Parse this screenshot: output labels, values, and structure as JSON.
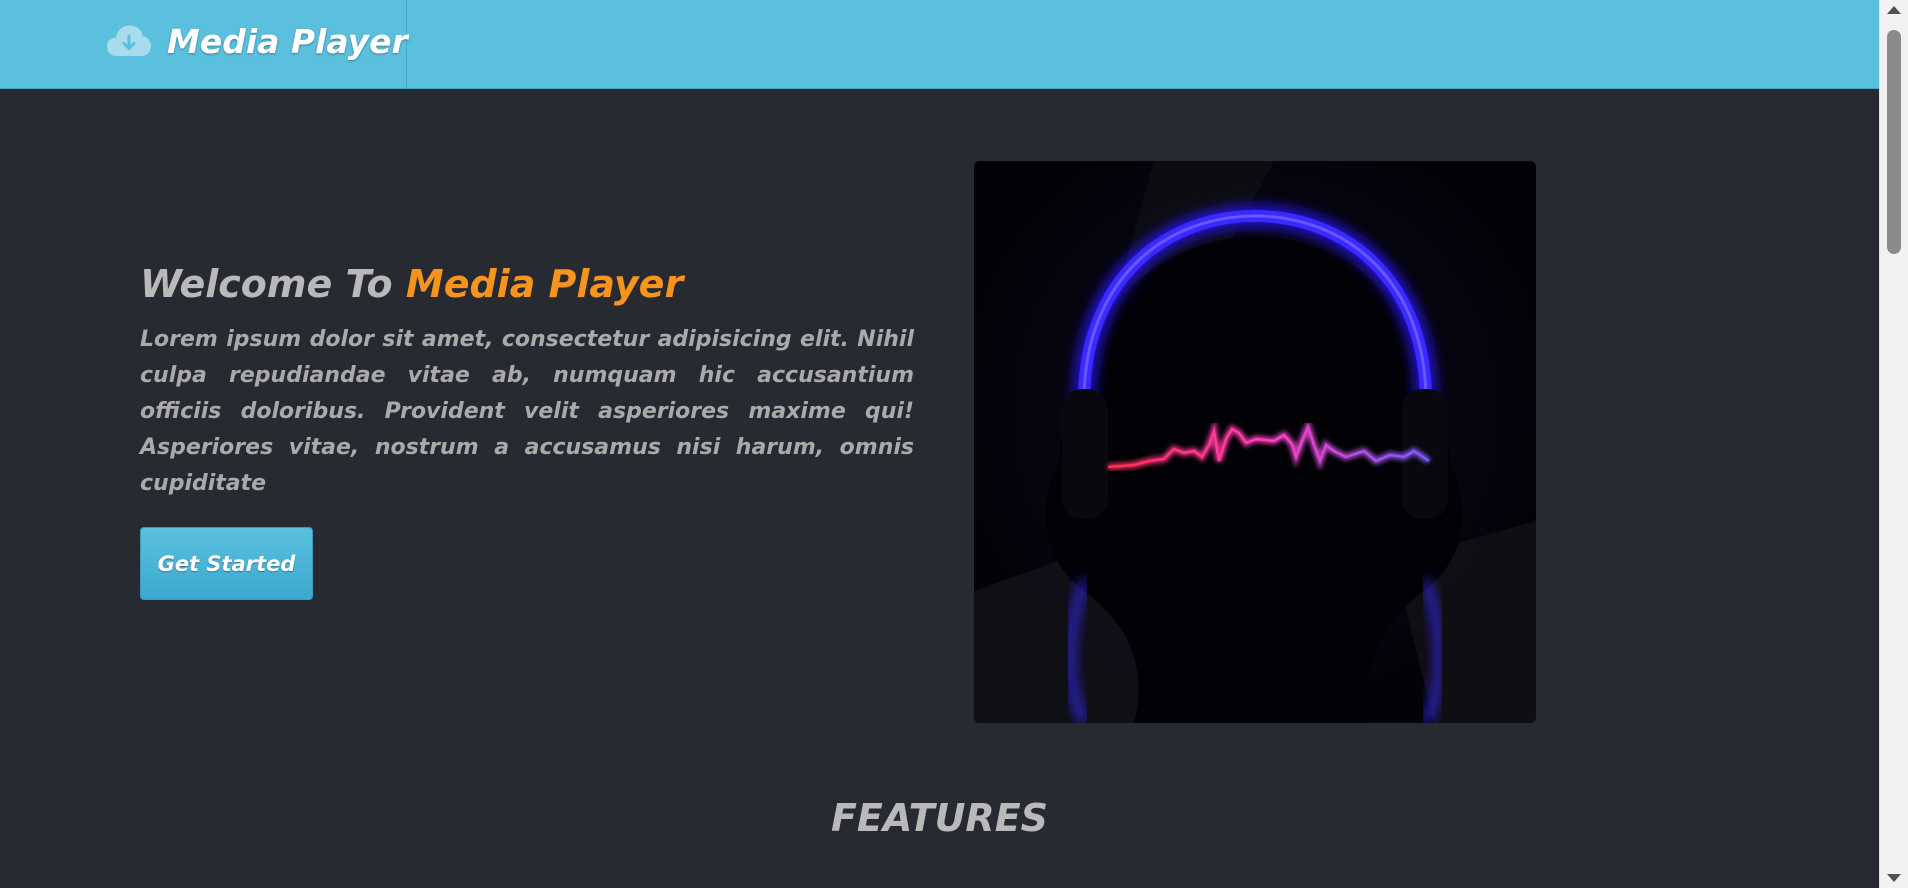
{
  "navbar": {
    "brand_icon": "cloud-download-icon",
    "brand_name": "Media Player",
    "color": "#5bc0de"
  },
  "hero": {
    "title_prefix": "Welcome To",
    "title_accent": "Media Player",
    "accent_color": "#f7941d",
    "description": "Lorem ipsum dolor sit amet, consectetur adipisicing elit. Nihil culpa repudiandae vitae ab, numquam hic accusantium officiis doloribus. Provident velit asperiores maxime qui! Asperiores vitae, nostrum a accusamus nisi harum, omnis cupiditate",
    "cta_label": "Get Started",
    "image": "headphones-soundwave-illustration"
  },
  "features": {
    "title": "FEATURES"
  },
  "scrollbar": {
    "up_icon": "scroll-up-arrow-icon",
    "down_icon": "scroll-down-arrow-icon"
  }
}
